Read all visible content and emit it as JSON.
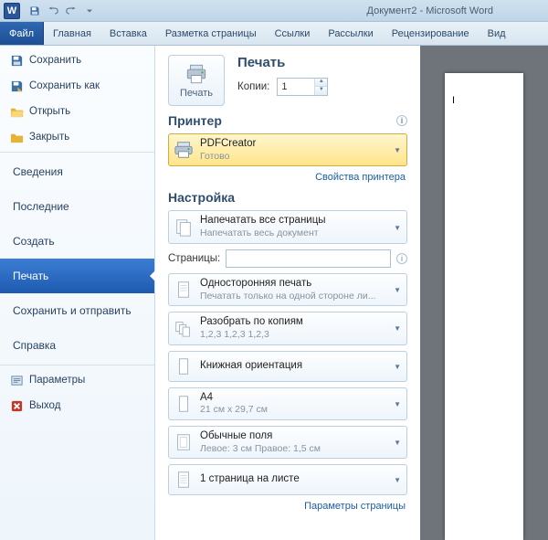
{
  "titlebar": {
    "app_icon_letter": "W",
    "title": "Документ2 - Microsoft Word"
  },
  "ribbon": {
    "file": "Файл",
    "tabs": [
      "Главная",
      "Вставка",
      "Разметка страницы",
      "Ссылки",
      "Рассылки",
      "Рецензирование",
      "Вид"
    ]
  },
  "nav": {
    "save": "Сохранить",
    "save_as": "Сохранить как",
    "open": "Открыть",
    "close": "Закрыть",
    "info": "Сведения",
    "recent": "Последние",
    "new": "Создать",
    "print": "Печать",
    "share": "Сохранить и отправить",
    "help": "Справка",
    "options": "Параметры",
    "exit": "Выход"
  },
  "print": {
    "button_label": "Печать",
    "heading": "Печать",
    "copies_label": "Копии:",
    "copies_value": "1",
    "printer_heading": "Принтер",
    "printer_name": "PDFCreator",
    "printer_status": "Готово",
    "printer_props_link": "Свойства принтера",
    "settings_heading": "Настройка",
    "print_all_title": "Напечатать все страницы",
    "print_all_sub": "Напечатать весь документ",
    "pages_label": "Страницы:",
    "pages_value": "",
    "one_sided_title": "Односторонняя печать",
    "one_sided_sub": "Печатать только на одной стороне ли...",
    "collate_title": "Разобрать по копиям",
    "collate_sub": "1,2,3   1,2,3   1,2,3",
    "orientation_title": "Книжная ориентация",
    "paper_title": "A4",
    "paper_sub": "21 см x 29,7 см",
    "margins_title": "Обычные поля",
    "margins_sub": "Левое: 3 см   Правое: 1,5 см",
    "sheets_title": "1 страница на листе",
    "page_setup_link": "Параметры страницы"
  },
  "preview": {
    "cursor": "I"
  }
}
